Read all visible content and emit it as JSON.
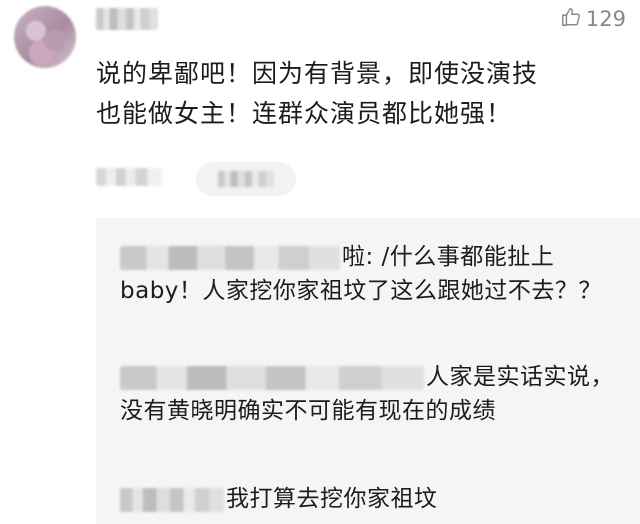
{
  "comment": {
    "likes": "129",
    "text": "说的卑鄙吧！因为有背景，即使没演技\n也能做女主！连群众演员都比她强！"
  },
  "replies": [
    {
      "text": "啦: /什么事都能扯上baby！人家挖你家祖坟了这么跟她过不去？？"
    },
    {
      "text": "人家是实话实说，没有黄晓明确实不可能有现在的成绩"
    },
    {
      "text": "我打算去挖你家祖坟"
    }
  ]
}
